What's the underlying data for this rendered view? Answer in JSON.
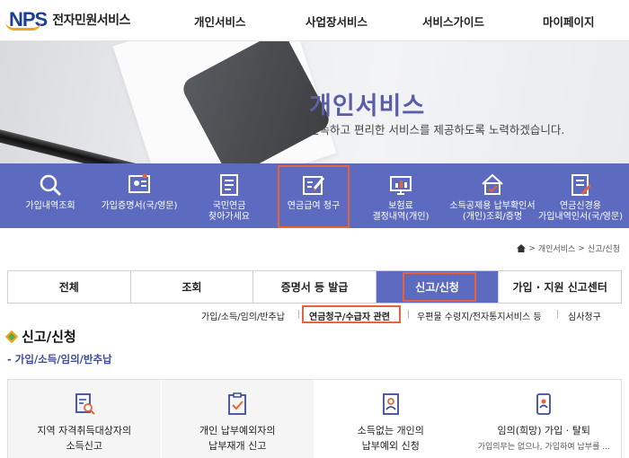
{
  "header": {
    "logo_text": "NPS",
    "service_name": "전자민원서비스",
    "nav": [
      "개인서비스",
      "사업장서비스",
      "서비스가이드",
      "마이페이지"
    ]
  },
  "hero": {
    "title": "개인서비스",
    "subtitle": "신속하고 편리한 서비스를 제공하도록 노력하겠습니다."
  },
  "quick_menu": [
    {
      "label": "가입내역조회",
      "icon": "search-icon"
    },
    {
      "label": "가입증명서(국/영문)",
      "icon": "certificate-icon"
    },
    {
      "label": "국민연금\n찾아가세요",
      "icon": "document-list-icon"
    },
    {
      "label": "연금급여 청구",
      "icon": "edit-form-icon"
    },
    {
      "label": "보험료\n결정내역(개인)",
      "icon": "monitor-chart-icon"
    },
    {
      "label": "소득공제용 납부확인서\n(개인)조회/증명",
      "icon": "house-check-icon"
    },
    {
      "label": "연금신경용\n가입내역인서(국/영문)",
      "icon": "document-pen-icon"
    }
  ],
  "breadcrumb": [
    "개인서비스",
    "신고/신청"
  ],
  "tabs": [
    "전체",
    "조회",
    "증명서 등 발급",
    "신고/신청",
    "가입 · 지원 신고센터"
  ],
  "subtabs": [
    "가입/소득/임의/반추납",
    "연금청구/수급자 관련",
    "우편물 수령지/전자통지서비스 등",
    "심사청구"
  ],
  "section": {
    "title": "신고/신청",
    "subheading": "가입/소득/임의/반추납"
  },
  "cards": [
    {
      "title": "지역 자격취득대상자의\n소득신고",
      "icon": "search-document-icon",
      "desc": ""
    },
    {
      "title": "개인 납부예외자의\n납부재개 신고",
      "icon": "clipboard-check-icon",
      "desc": ""
    },
    {
      "title": "소득없는 개인의\n납부예외 신청",
      "icon": "id-card-icon",
      "desc": ""
    },
    {
      "title": "임의(희망) 가입 · 탈퇴",
      "icon": "mobile-user-icon",
      "desc": "가입의무는 없으나, 가입하여 납부를 ..."
    }
  ],
  "colors": {
    "brand_blue": "#5c6bc0",
    "highlight": "#e8633a",
    "logo_blue": "#1d3f93",
    "logo_orange": "#f2a51b"
  }
}
